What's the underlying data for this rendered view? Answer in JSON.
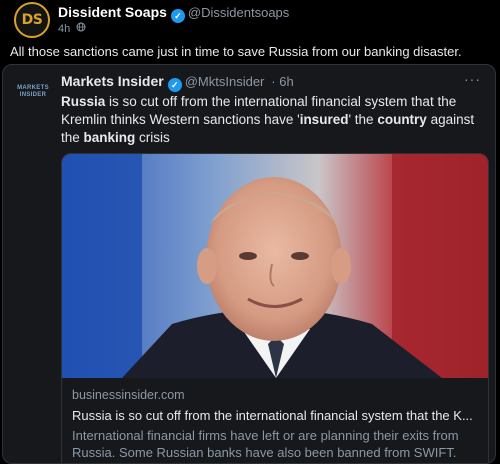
{
  "outer": {
    "avatar_text": "DS",
    "display_name": "Dissident Soaps",
    "handle": "@Dissidentsoaps",
    "time": "4h",
    "visibility_icon": "globe-icon",
    "text": "All those sanctions came just in time to save Russia from our banking disaster."
  },
  "quoted": {
    "logo_text_1": "MARKETS",
    "logo_text_2": "INSIDER",
    "display_name": "Markets Insider",
    "handle": "@MktsInsider",
    "time": "· 6h",
    "menu": "···",
    "text_parts": {
      "p1": "Russia",
      "p2": " is so cut off from the international financial system that the Kremlin thinks Western sanctions have '",
      "p3": "insured",
      "p4": "' the ",
      "p5": "country",
      "p6": " against the ",
      "p7": "banking",
      "p8": " crisis"
    },
    "link_card": {
      "domain": "businessinsider.com",
      "title": "Russia is so cut off from the international financial system that the K...",
      "description": "International financial firms have left or are planning their exits from Russia. Some Russian banks have also been banned from SWIFT."
    }
  },
  "colors": {
    "accent_verified": "#1d9bf0",
    "background": "#000000",
    "card_background": "#16181c"
  }
}
